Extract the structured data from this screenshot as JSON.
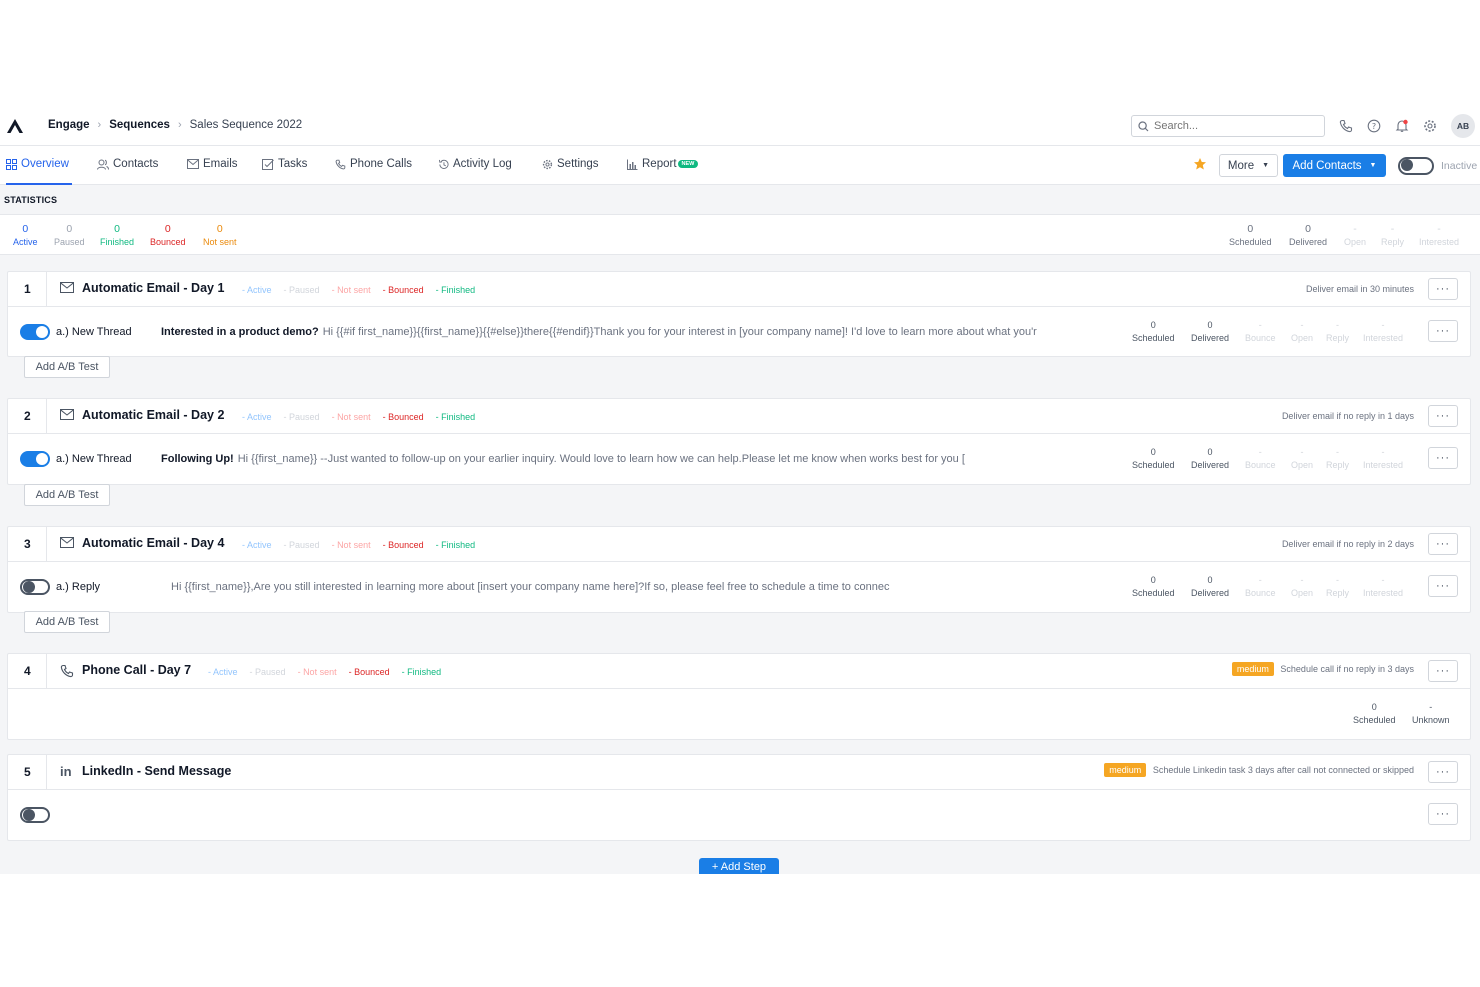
{
  "header": {
    "breadcrumbs": [
      "Engage",
      "Sequences",
      "Sales Sequence 2022"
    ],
    "search_placeholder": "Search...",
    "avatar_initials": "AB"
  },
  "tabs": [
    {
      "label": "Overview",
      "icon": "grid-icon"
    },
    {
      "label": "Contacts",
      "icon": "users-icon"
    },
    {
      "label": "Emails",
      "icon": "mail-icon"
    },
    {
      "label": "Tasks",
      "icon": "task-icon"
    },
    {
      "label": "Phone Calls",
      "icon": "phone-icon"
    },
    {
      "label": "Activity Log",
      "icon": "history-icon"
    },
    {
      "label": "Settings",
      "icon": "gear-icon"
    },
    {
      "label": "Report",
      "icon": "chart-icon",
      "badge": "NEW"
    }
  ],
  "toolbar": {
    "more_label": "More",
    "add_contacts_label": "Add Contacts",
    "status_label": "Inactive"
  },
  "statistics": {
    "title": "STATISTICS",
    "left": [
      {
        "value": "0",
        "label": "Active"
      },
      {
        "value": "0",
        "label": "Paused"
      },
      {
        "value": "0",
        "label": "Finished"
      },
      {
        "value": "0",
        "label": "Bounced"
      },
      {
        "value": "0",
        "label": "Not sent"
      }
    ],
    "right": [
      {
        "value": "0",
        "label": "Scheduled"
      },
      {
        "value": "0",
        "label": "Delivered"
      },
      {
        "value": "-",
        "label": "Open"
      },
      {
        "value": "-",
        "label": "Reply"
      },
      {
        "value": "-",
        "label": "Interested"
      }
    ]
  },
  "status_labels": [
    "Active",
    "Paused",
    "Not sent",
    "Bounced",
    "Finished"
  ],
  "email_metrics": [
    {
      "value": "0",
      "label": "Scheduled"
    },
    {
      "value": "0",
      "label": "Delivered"
    },
    {
      "value": "-",
      "label": "Bounce"
    },
    {
      "value": "-",
      "label": "Open"
    },
    {
      "value": "-",
      "label": "Reply"
    },
    {
      "value": "-",
      "label": "Interested"
    }
  ],
  "add_ab_label": "Add A/B Test",
  "steps": [
    {
      "number": "1",
      "title": "Automatic Email - Day 1",
      "schedule": "Deliver email in 30 minutes",
      "thread_label": "a.) New Thread",
      "subject": "Interested in a product demo?",
      "body": "Hi {{#if first_name}}{{first_name}}{{#else}}there{{#endif}}Thank you for your interest in [your company name]! I'd love to learn more about what you'r",
      "enabled": true
    },
    {
      "number": "2",
      "title": "Automatic Email - Day 2",
      "schedule": "Deliver email if no reply in 1 days",
      "thread_label": "a.) New Thread",
      "subject": "Following Up!",
      "body": "Hi {{first_name}} --Just wanted to follow-up on your earlier inquiry. Would love to learn how we can help.Please let me know when works best for you [",
      "enabled": true
    },
    {
      "number": "3",
      "title": "Automatic Email - Day 4",
      "schedule": "Deliver email if no reply in 2 days",
      "thread_label": "a.) Reply",
      "subject": "",
      "body": "Hi {{first_name}},Are you still interested in learning more about [insert your company name here]?If so, please feel free to schedule a time to connec",
      "enabled": false
    },
    {
      "number": "4",
      "title": "Phone Call - Day 7",
      "priority": "medium",
      "schedule": "Schedule call if no reply in 3 days",
      "metrics": [
        {
          "value": "0",
          "label": "Scheduled"
        },
        {
          "value": "-",
          "label": "Unknown"
        }
      ]
    },
    {
      "number": "5",
      "title": "LinkedIn - Send Message",
      "priority": "medium",
      "schedule": "Schedule Linkedin task 3 days after call not connected or skipped",
      "enabled": false
    }
  ],
  "add_step_label": "+ Add Step",
  "colors": {
    "primary": "#1a7ee6",
    "active": "#2563eb",
    "finished": "#10b981",
    "bounced": "#dc2626",
    "not_sent": "#ea8a0c",
    "priority": "#f5a623"
  }
}
